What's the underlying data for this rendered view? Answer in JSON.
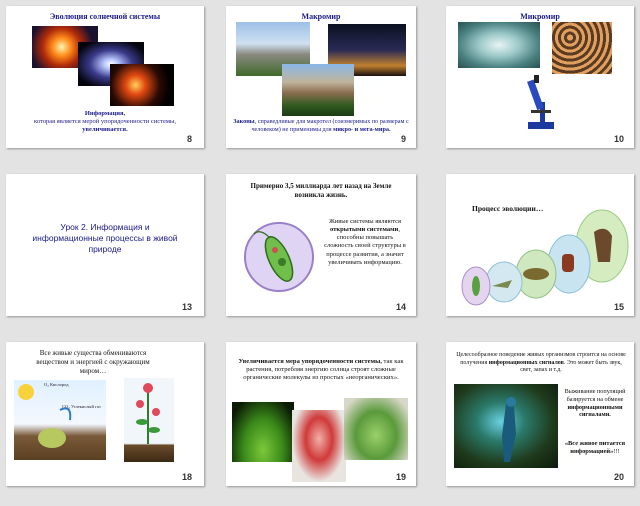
{
  "slides": [
    {
      "number": "8",
      "title": "Эволюция солнечной системы",
      "caption_bold": "Информация,",
      "caption_rest": "которая является мерой упорядоченности системы,",
      "caption_end": "увеличивается."
    },
    {
      "number": "9",
      "title": "Макромир",
      "caption_bold": "Законы",
      "caption_rest": ", справедливые для макротел (соизмеримых по размерам с человеком) не применимы для",
      "caption_end": "микро- и мега-мира."
    },
    {
      "number": "10",
      "title": "Микромир"
    },
    {
      "number": "13",
      "title": "Урок 2. Информация и информационные процессы в живой природе"
    },
    {
      "number": "14",
      "heading": "Примерно 3,5 миллиарда лет назад на Земле возникла жизнь.",
      "body_start": "Живые системы являются",
      "body_bold": "открытыми системами",
      "body_rest": ", способны повышать сложность своей структуры в процессе развития, а значит увеличивать информацию."
    },
    {
      "number": "15",
      "title": "Процесс эволюции…"
    },
    {
      "number": "18",
      "heading": "Все живые существа обмениваются веществом и энергией с окружающим миром…",
      "label_co2": "O₂ Кислород",
      "label_o2": "CO₂ Углекислый газ"
    },
    {
      "number": "19",
      "heading_bold": "Увеличивается мера упорядоченности системы,",
      "heading_rest": "так как растения, потребляя энергию солнца строят сложные органические молекулы из простых «неорганических»."
    },
    {
      "number": "20",
      "heading": "Целесообразное поведение живых организмов строится на основе получения",
      "heading_bold": "информационных сигналов",
      "heading_rest": ". Это может быть звук, свет, запах и т.д.",
      "side_text": "Выживание популяций базируется на обмене",
      "side_bold": "информационными сигналами.",
      "quote": "«Все живое питается информацией»",
      "quote_end": "!!!"
    }
  ]
}
